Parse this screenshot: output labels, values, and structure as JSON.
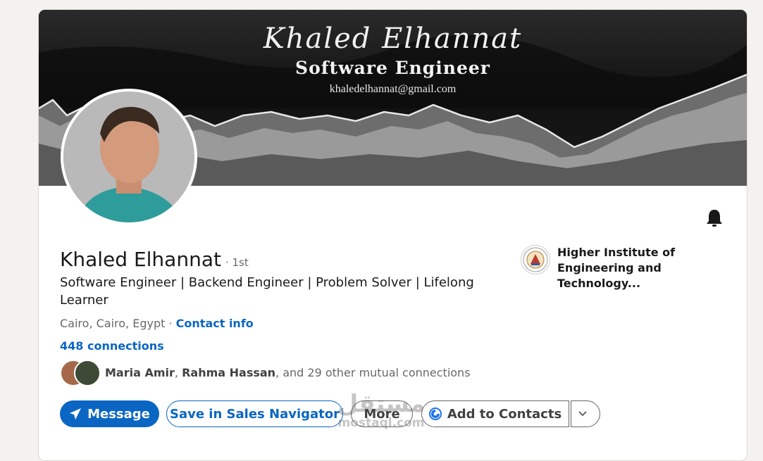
{
  "banner": {
    "name": "Khaled Elhannat",
    "role": "Software Engineer",
    "email": "khaledelhannat@gmail.com"
  },
  "profile": {
    "name": "Khaled Elhannat",
    "degree": "· 1st",
    "headline": "Software Engineer | Backend Engineer | Problem Solver | Lifelong Learner",
    "location": "Cairo, Cairo, Egypt",
    "location_separator": "·",
    "contact_info": "Contact info",
    "connections": "448 connections",
    "mutual": {
      "name1": "Maria Amir",
      "sep": ",",
      "name2": "Rahma Hassan",
      "rest": ", and 29 other mutual connections"
    }
  },
  "education": {
    "name": "Higher Institute of Engineering and Technology..."
  },
  "actions": {
    "message": "Message",
    "sales_navigator": "Save in Sales Navigator",
    "more": "More",
    "add_contacts": "Add to Contacts"
  },
  "watermark": {
    "arabic": "مستقل",
    "latin": "mostaql.com"
  },
  "colors": {
    "accent": "#0a66c2",
    "background": "#f4f2ee"
  },
  "icons": {
    "message": "send-icon",
    "notify": "bell-icon",
    "contacts": "google-contacts-icon",
    "caret": "chevron-down-icon"
  }
}
